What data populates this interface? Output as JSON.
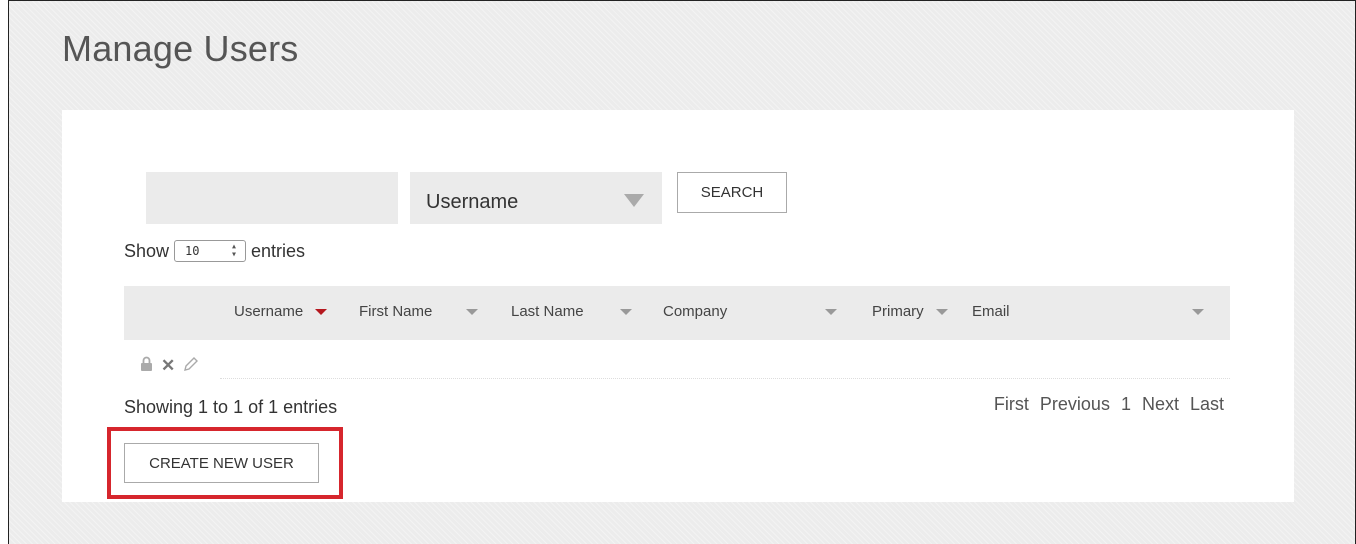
{
  "page": {
    "title": "Manage Users"
  },
  "search": {
    "input_value": "",
    "field_selected": "Username",
    "button_label": "SEARCH"
  },
  "length": {
    "prefix": "Show",
    "value": "10",
    "suffix": "entries"
  },
  "table": {
    "columns": [
      {
        "label": "Username",
        "sorted": true
      },
      {
        "label": "First Name",
        "sorted": false
      },
      {
        "label": "Last Name",
        "sorted": false
      },
      {
        "label": "Company",
        "sorted": false
      },
      {
        "label": "Primary",
        "sorted": false
      },
      {
        "label": "Email",
        "sorted": false
      }
    ],
    "row_actions": {
      "lock": "lock-icon",
      "delete": "close-icon",
      "edit": "pencil-icon"
    }
  },
  "info": {
    "text": "Showing 1 to 1 of 1 entries"
  },
  "pager": {
    "first": "First",
    "previous": "Previous",
    "page": "1",
    "next": "Next",
    "last": "Last"
  },
  "actions": {
    "create_label": "CREATE NEW USER"
  },
  "colors": {
    "accent": "#b5171e",
    "highlight": "#d6262d",
    "panel_bg": "#ebebeb"
  }
}
